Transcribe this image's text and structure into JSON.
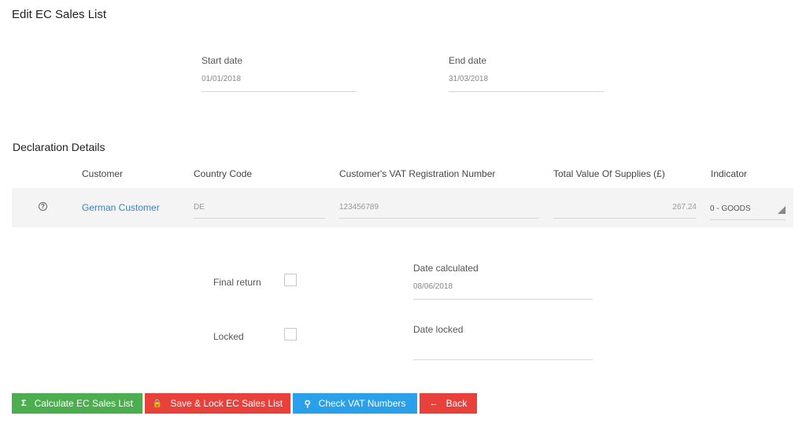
{
  "page": {
    "title": "Edit EC Sales List"
  },
  "period": {
    "start_label": "Start date",
    "start_value": "01/01/2018",
    "end_label": "End date",
    "end_value": "31/03/2018"
  },
  "declaration": {
    "title": "Declaration Details",
    "columns": [
      "Customer",
      "Country Code",
      "Customer's VAT Registration Number",
      "Total Value Of Supplies (£)",
      "Indicator"
    ],
    "rows": [
      {
        "help_icon": "question-circle-icon",
        "customer": "German Customer",
        "country_code": "DE",
        "vat_number": "123456789",
        "total_value": "267.24",
        "indicator": "0 - GOODS"
      }
    ]
  },
  "status": {
    "final_return_label": "Final return",
    "final_return_checked": false,
    "locked_label": "Locked",
    "locked_checked": false,
    "date_calculated_label": "Date calculated",
    "date_calculated_value": "08/06/2018",
    "date_locked_label": "Date locked",
    "date_locked_value": ""
  },
  "buttons": {
    "calculate": {
      "label": "Calculate EC Sales List",
      "icon": "sigma-icon",
      "glyph": "Σ",
      "color": "#4cae4f"
    },
    "save_lock": {
      "label": "Save & Lock EC Sales List",
      "icon": "lock-icon",
      "glyph": "🔒",
      "color": "#e8403a"
    },
    "check_vat": {
      "label": "Check VAT Numbers",
      "icon": "search-icon",
      "glyph": "⚲",
      "color": "#2a9fea"
    },
    "back": {
      "label": "Back",
      "icon": "arrow-left-icon",
      "glyph": "←",
      "color": "#e8403a"
    }
  }
}
